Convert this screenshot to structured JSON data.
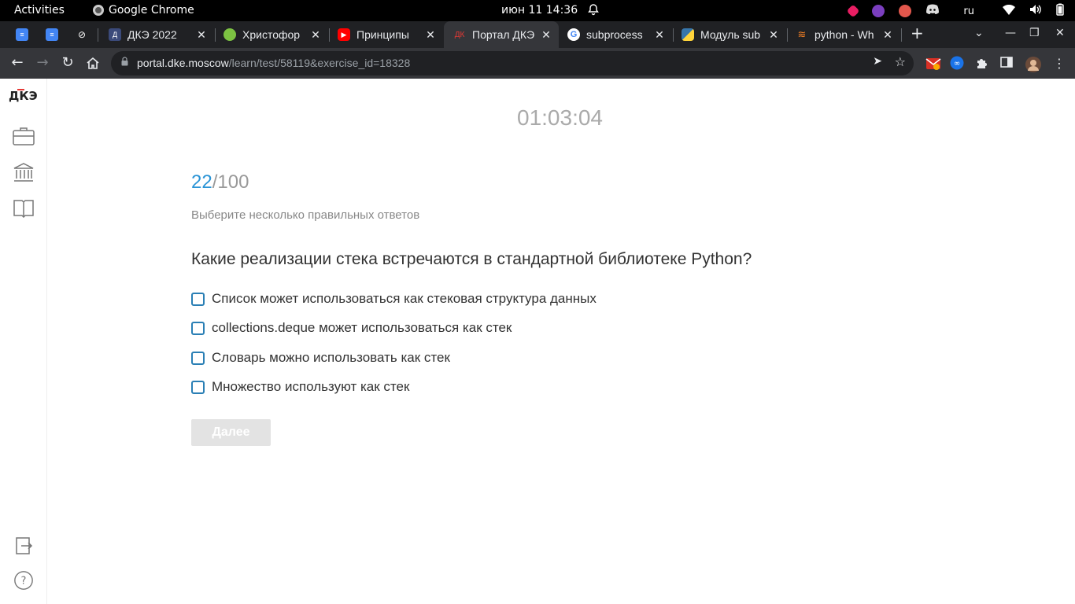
{
  "system": {
    "activities": "Activities",
    "app_name": "Google Chrome",
    "clock": "июн 11  14:36",
    "lang": "ru"
  },
  "tabs": [
    {
      "title": "",
      "favicon": "docs-icon",
      "color": "#4285f4"
    },
    {
      "title": "",
      "favicon": "docs-icon",
      "color": "#4285f4"
    },
    {
      "title": "",
      "favicon": "link-icon",
      "color": "#202124"
    },
    {
      "title": "ДКЭ 2022",
      "favicon": "dke-icon",
      "color": "#3b4a7a"
    },
    {
      "title": "Христофор",
      "favicon": "circle-icon",
      "color": "#7cc242"
    },
    {
      "title": "Принципы",
      "favicon": "youtube-icon",
      "color": "#ff0000"
    },
    {
      "title": "Портал ДКЭ",
      "favicon": "dke-icon",
      "color": "#35363a"
    },
    {
      "title": "subprocess",
      "favicon": "google-icon",
      "color": "#ffffff"
    },
    {
      "title": "Модуль sub",
      "favicon": "python-icon",
      "color": "#3776ab"
    },
    {
      "title": "python - Wh",
      "favicon": "stackoverflow-icon",
      "color": "#f48024"
    }
  ],
  "browser": {
    "url_host": "portal.dke.moscow",
    "url_path": "/learn/test/58119&exercise_id=18328"
  },
  "sidebar": {
    "logo": "ДКЭ"
  },
  "test": {
    "timer": "01:03:04",
    "current": "22",
    "total": "/100",
    "hint": "Выберите несколько правильных ответов",
    "question": "Какие реализации стека встречаются в стандартной библиотеке Python?",
    "answers": [
      "Список может использоваться как стековая структура данных",
      "collections.deque может использоваться как стек",
      "Словарь можно использовать как стек",
      "Множество используют как стек"
    ],
    "next_label": "Далее"
  },
  "colors": {
    "accent": "#2a94d6",
    "checkbox_border": "#2a7fb5",
    "disabled_button": "#e3e3e3"
  }
}
